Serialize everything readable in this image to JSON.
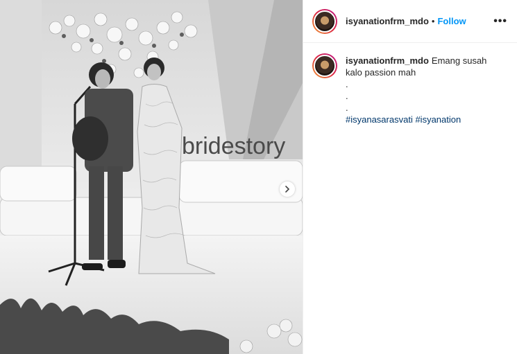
{
  "post": {
    "username": "isyanationfrm_mdo",
    "separator": "•",
    "follow_label": "Follow",
    "more_label": "•••",
    "media": {
      "sign_text": "bridestory"
    },
    "caption": {
      "text_first": "Emang susah kalo passion mah",
      "dot_lines": [
        ".",
        ".",
        "."
      ],
      "hashtags": [
        "#isyanasarasvati",
        "#isyanation"
      ]
    }
  }
}
